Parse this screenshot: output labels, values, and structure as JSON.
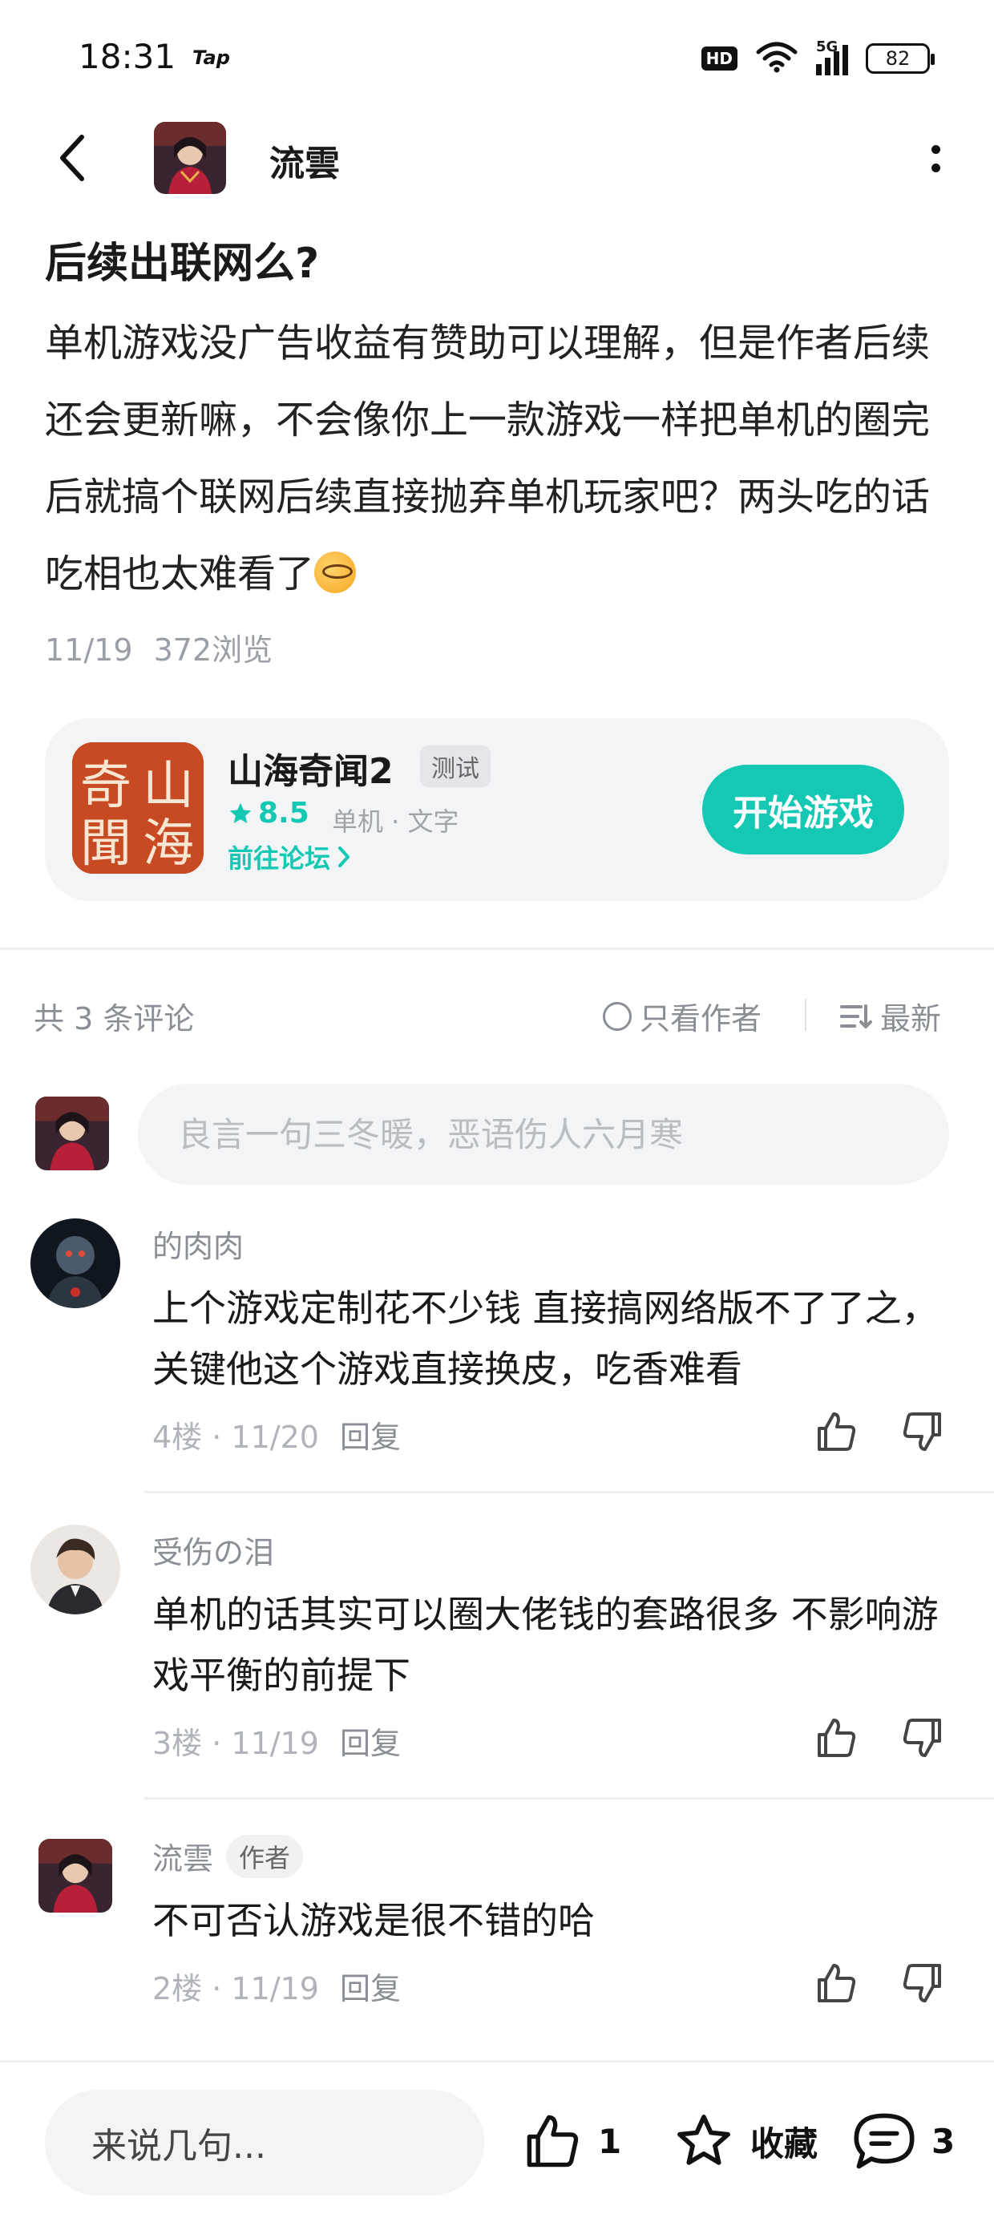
{
  "status_bar": {
    "time": "18:31",
    "app_badge": "Tap",
    "hd": "HD",
    "network": "5G",
    "battery": "82"
  },
  "header": {
    "author_name": "流雲"
  },
  "post": {
    "title": "后续出联网么?",
    "body": "单机游戏没广告收益有赞助可以理解，但是作者后续还会更新嘛，不会像你上一款游戏一样把单机的圈完后就搞个联网后续直接抛弃单机玩家吧？两头吃的话吃相也太难看了",
    "date": "11/19",
    "views": "372浏览"
  },
  "game_card": {
    "name": "山海奇闻2",
    "tag": "测试",
    "rating": "8.5",
    "genre": "单机 · 文字",
    "forum_link": "前往论坛",
    "play_button": "开始游戏",
    "icon_chars": [
      "奇",
      "山",
      "聞",
      "海"
    ]
  },
  "comments_bar": {
    "count": "共 3 条评论",
    "filter_author": "只看作者",
    "sort": "最新"
  },
  "comment_input": {
    "placeholder": "良言一句三冬暖，恶语伤人六月寒"
  },
  "comments": [
    {
      "user": "的肉肉",
      "text": "上个游戏定制花不少钱 直接搞网络版不了了之，关键他这个游戏直接换皮，吃香难看",
      "floor_date": "4楼 · 11/20",
      "reply": "回复"
    },
    {
      "user": "受伤の泪",
      "text": "单机的话其实可以圈大佬钱的套路很多 不影响游戏平衡的前提下",
      "floor_date": "3楼 · 11/19",
      "reply": "回复"
    },
    {
      "user": "流雲",
      "author_tag": "作者",
      "text": "不可否认游戏是很不错的哈",
      "floor_date": "2楼 · 11/19",
      "reply": "回复"
    }
  ],
  "bottom_bar": {
    "input_placeholder": "来说几句...",
    "like_count": "1",
    "favorite_label": "收藏",
    "comment_count": "3"
  },
  "colors": {
    "accent": "#14c8b4",
    "muted_text": "#8a8e95",
    "card_bg": "#f3f4f6"
  }
}
